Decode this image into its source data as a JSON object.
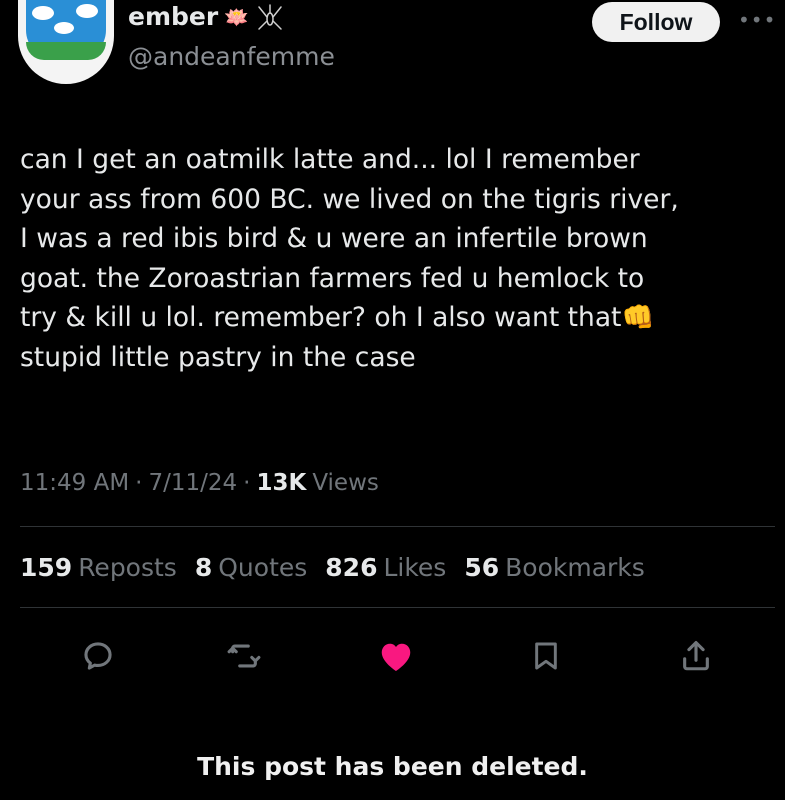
{
  "user": {
    "name": "ember",
    "name_emoji": "🪷",
    "handle": "@andeanfemme"
  },
  "header": {
    "follow_label": "Follow",
    "more_label": "•••"
  },
  "tweet": {
    "text_before_emoji": "can I get an oatmilk latte and... lol I remember\nyour ass from 600 BC. we lived on the tigris river,\nI was a red ibis bird & u were an infertile brown\ngoat. the Zoroastrian farmers fed u hemlock to\ntry & kill u lol. remember? oh I also want that",
    "inline_emoji": "👊",
    "text_after_emoji": "\nstupid little pastry in the case"
  },
  "meta": {
    "time": "11:49 AM",
    "date": "7/11/24",
    "views_count": "13K",
    "views_label": "Views",
    "separator": "·"
  },
  "stats": {
    "reposts_count": "159",
    "reposts_label": "Reposts",
    "quotes_count": "8",
    "quotes_label": "Quotes",
    "likes_count": "826",
    "likes_label": "Likes",
    "bookmarks_count": "56",
    "bookmarks_label": "Bookmarks"
  },
  "actions": {
    "icons": [
      "reply-icon",
      "repost-icon",
      "like-icon",
      "bookmark-icon",
      "share-icon"
    ],
    "like_color": "#f91880",
    "muted_color": "#71767b"
  },
  "footer": {
    "deleted_notice": "This post has been deleted."
  }
}
